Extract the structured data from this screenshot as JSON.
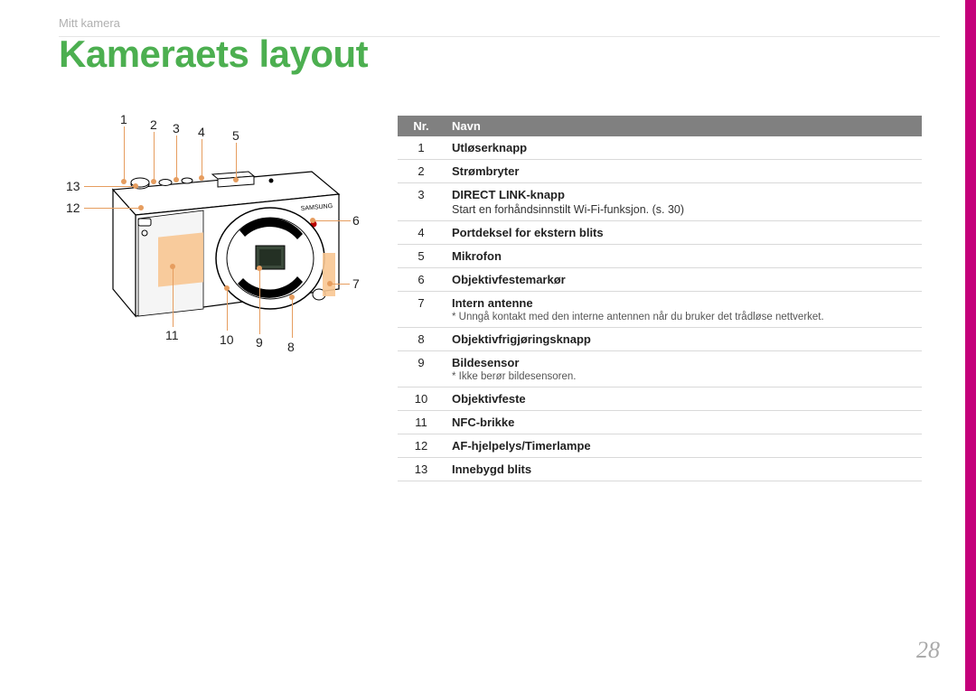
{
  "breadcrumb": "Mitt kamera",
  "title": "Kameraets layout",
  "page_number": "28",
  "table": {
    "headers": {
      "nr": "Nr.",
      "navn": "Navn"
    },
    "rows": [
      {
        "nr": "1",
        "name": "Utløserknapp"
      },
      {
        "nr": "2",
        "name": "Strømbryter"
      },
      {
        "nr": "3",
        "name": "DIRECT LINK-knapp",
        "desc": "Start en forhåndsinnstilt Wi-Fi-funksjon. (s. 30)"
      },
      {
        "nr": "4",
        "name": "Portdeksel for ekstern blits"
      },
      {
        "nr": "5",
        "name": "Mikrofon"
      },
      {
        "nr": "6",
        "name": "Objektivfestemarkør"
      },
      {
        "nr": "7",
        "name": "Intern antenne",
        "note": "* Unngå kontakt med den interne antennen når du bruker det trådløse nettverket."
      },
      {
        "nr": "8",
        "name": "Objektivfrigjøringsknapp"
      },
      {
        "nr": "9",
        "name": "Bildesensor",
        "note": "* Ikke berør bildesensoren."
      },
      {
        "nr": "10",
        "name": "Objektivfeste"
      },
      {
        "nr": "11",
        "name": "NFC-brikke"
      },
      {
        "nr": "12",
        "name": "AF-hjelpelys/Timerlampe"
      },
      {
        "nr": "13",
        "name": "Innebygd blits"
      }
    ]
  },
  "callouts": {
    "c1": "1",
    "c2": "2",
    "c3": "3",
    "c4": "4",
    "c5": "5",
    "c6": "6",
    "c7": "7",
    "c8": "8",
    "c9": "9",
    "c10": "10",
    "c11": "11",
    "c12": "12",
    "c13": "13"
  }
}
